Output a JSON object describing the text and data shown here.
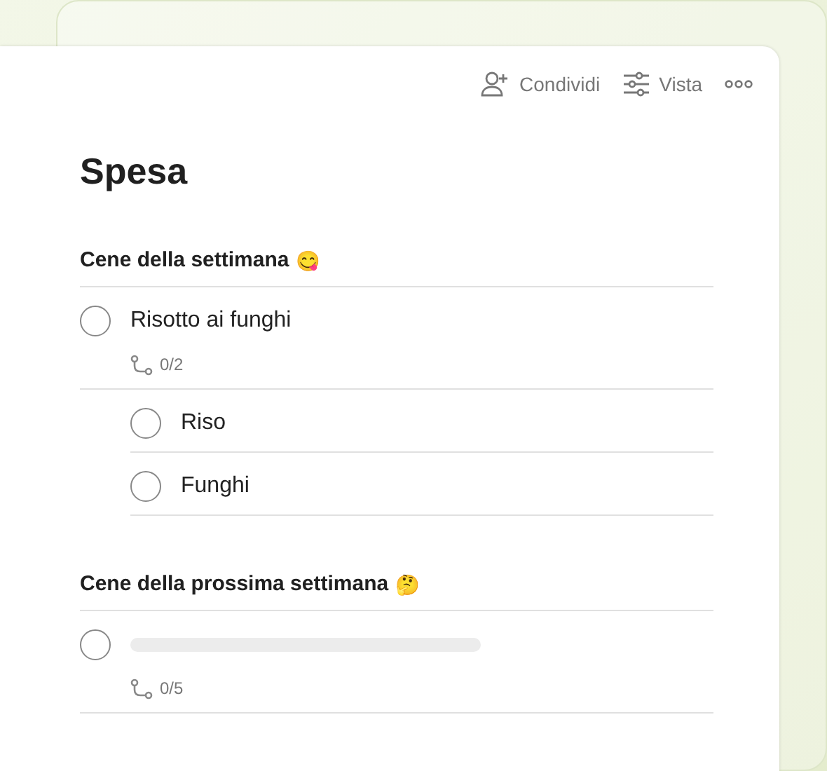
{
  "toolbar": [
    {
      "kind": "share",
      "label": "Condividi"
    },
    {
      "kind": "view",
      "label": "Vista"
    },
    {
      "kind": "more"
    }
  ],
  "title": "Spesa",
  "sections": [
    {
      "name": "Cene della settimana",
      "emoji": "😋",
      "tasks": [
        {
          "kind": "task",
          "title": "Risotto ai funghi",
          "checked": false,
          "subtask_count": "0/2",
          "children": [
            {
              "kind": "task",
              "title": "Riso",
              "checked": false
            },
            {
              "kind": "task",
              "title": "Funghi",
              "checked": false
            }
          ]
        }
      ]
    },
    {
      "name": "Cene della prossima settimana",
      "emoji": "🤔",
      "tasks": [
        {
          "kind": "skeleton",
          "checked": false,
          "subtask_count": "0/5"
        }
      ]
    }
  ]
}
